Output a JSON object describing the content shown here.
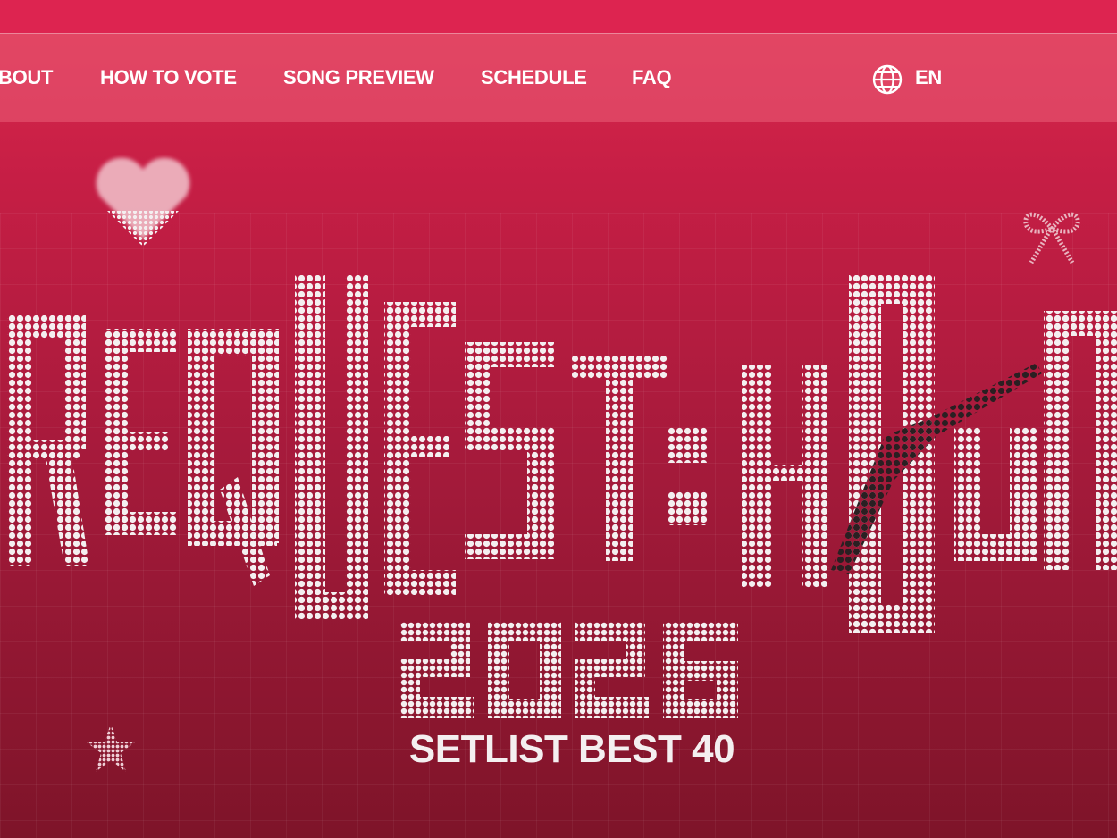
{
  "nav": {
    "items": [
      {
        "label": "BOUT"
      },
      {
        "label": "HOW TO VOTE"
      },
      {
        "label": "SONG PREVIEW"
      },
      {
        "label": "SCHEDULE"
      },
      {
        "label": "FAQ"
      }
    ],
    "language": {
      "label": "EN",
      "icon": "globe-icon"
    }
  },
  "hero": {
    "title": "REQUEST:HOUR",
    "year": "2026",
    "subtitle": "SETLIST BEST 40",
    "decorations": [
      "heart-icon",
      "ribbon-icon",
      "star-icon"
    ]
  },
  "colors": {
    "top_strip": "#dd2450",
    "background_top": "#dc2a4d",
    "background_bottom": "#7e1429",
    "lettering": "#f4eff0",
    "accent_dark": "#2a1f22"
  }
}
